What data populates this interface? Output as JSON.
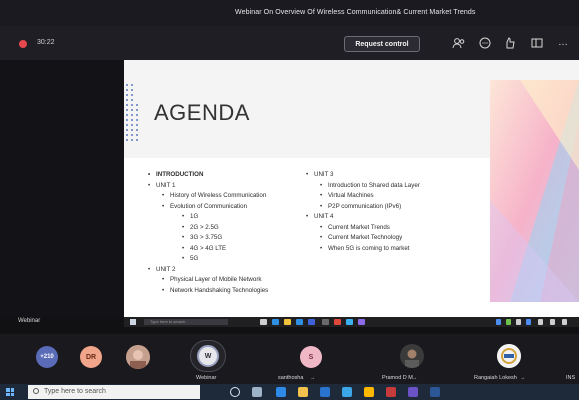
{
  "window": {
    "title": "Webinar On Overview Of Wireless Communication& Current Market Trends"
  },
  "toolbar": {
    "timer": "30:22",
    "request_control_label": "Request control",
    "more_label": "…"
  },
  "slide": {
    "heading": "AGENDA",
    "left_column": [
      {
        "level": 1,
        "text": "INTRODUCTION",
        "bold": true
      },
      {
        "level": 1,
        "text": "UNIT 1"
      },
      {
        "level": 2,
        "text": "History of Wireless Communication"
      },
      {
        "level": 2,
        "text": "Evolution of Communication"
      },
      {
        "level": 3,
        "text": "1G"
      },
      {
        "level": 3,
        "text": "2G > 2.5G"
      },
      {
        "level": 3,
        "text": "3G > 3.75G"
      },
      {
        "level": 3,
        "text": "4G > 4G LTE"
      },
      {
        "level": 3,
        "text": "5G"
      },
      {
        "level": 1,
        "text": "UNIT 2"
      },
      {
        "level": 2,
        "text": "Physical Layer of Mobile Network"
      },
      {
        "level": 2,
        "text": "Network Handshaking Technologies"
      }
    ],
    "right_column": [
      {
        "level": 1,
        "text": "UNIT 3"
      },
      {
        "level": 2,
        "text": "Introduction to Shared data Layer"
      },
      {
        "level": 2,
        "text": "Virtual Machines"
      },
      {
        "level": 2,
        "text": "P2P communication (IPv6)"
      },
      {
        "level": 1,
        "text": "UNIT 4"
      },
      {
        "level": 2,
        "text": "Current Market Trends"
      },
      {
        "level": 2,
        "text": "Current Market Technology"
      },
      {
        "level": 2,
        "text": "When 5G is coming to market"
      }
    ]
  },
  "stage": {
    "presenter_label": "Webinar"
  },
  "slide_strip": {
    "search_text": "Type here to search"
  },
  "participants": {
    "overflow_count": "+210",
    "initials_dr": "DR",
    "initials_s": "S",
    "initials_w": "W",
    "names": [
      "Webinar",
      "santhosha",
      "Pramod D M",
      "Rangaiah Lokesh",
      "INS"
    ],
    "mic_glyph": "→"
  },
  "taskbar": {
    "search_placeholder": "Type here to search"
  },
  "colors": {
    "accent": "#5a7bc0",
    "recording": "#e5484d",
    "avatar_dr": "#f1a58a",
    "avatar_s": "#f0b8c7",
    "avatar_overflow": "#5a6bb7"
  }
}
